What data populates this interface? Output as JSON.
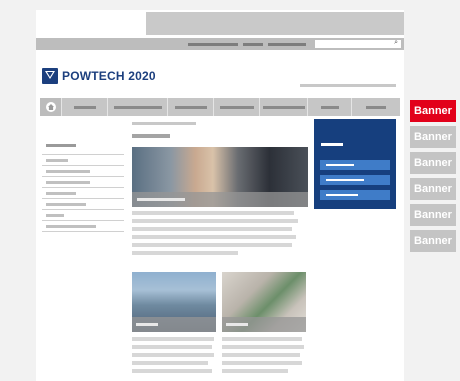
{
  "logo": {
    "text": "POWTECH 2020",
    "brand_color": "#1c3f7e"
  },
  "nav": {
    "home_icon": "home-icon"
  },
  "search": {
    "icon": "search-icon",
    "glyph": "🔍"
  },
  "banners": [
    {
      "label": "Banner",
      "active": true,
      "color": "#e2001a"
    },
    {
      "label": "Banner",
      "active": false,
      "color": "#c4c4c4"
    },
    {
      "label": "Banner",
      "active": false,
      "color": "#c4c4c4"
    },
    {
      "label": "Banner",
      "active": false,
      "color": "#c4c4c4"
    },
    {
      "label": "Banner",
      "active": false,
      "color": "#c4c4c4"
    },
    {
      "label": "Banner",
      "active": false,
      "color": "#c4c4c4"
    }
  ],
  "colors": {
    "highlight_box": "#163f7e",
    "box_links": "#3f7cc8",
    "page_bg": "#f2f2f2"
  }
}
